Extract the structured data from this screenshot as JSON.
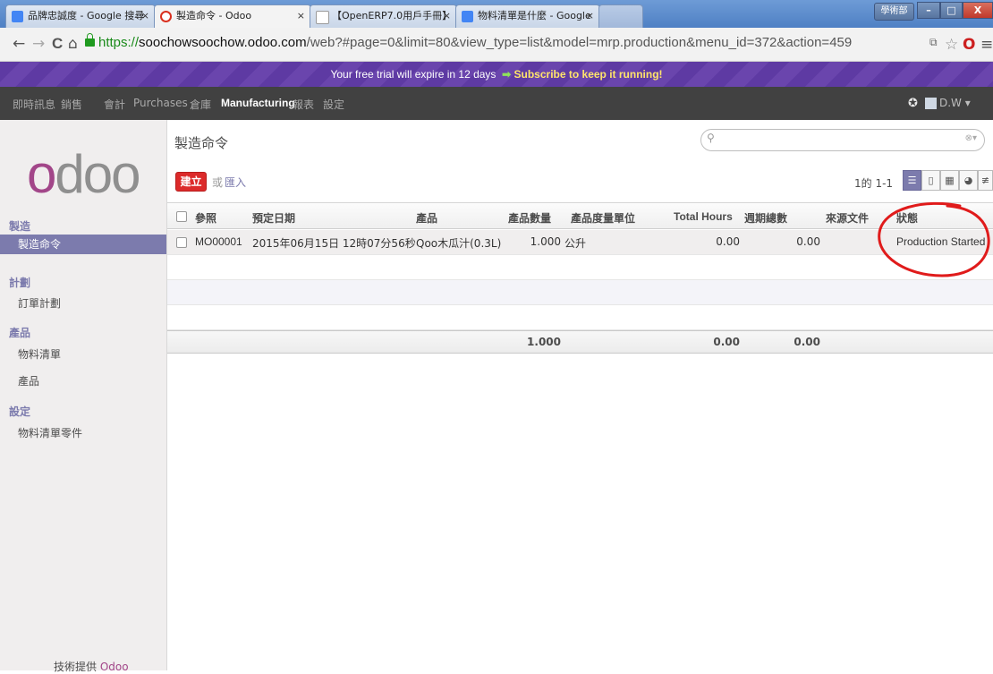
{
  "browser": {
    "tabs": [
      {
        "label": "品牌忠誠度 - Google 搜尋",
        "icon": "google-icon",
        "color": "#4285f4"
      },
      {
        "label": "製造命令 - Odoo",
        "icon": "odoo-icon",
        "color": "#d9301f"
      },
      {
        "label": "【OpenERP7.0用戶手冊】",
        "icon": "page-icon",
        "color": "#ffffff"
      },
      {
        "label": "物料清單是什麼 - Google",
        "icon": "google-icon",
        "color": "#4285f4"
      }
    ],
    "window_user": "學術部",
    "window_buttons": {
      "minimize": "–",
      "maximize": "□",
      "close": "X"
    },
    "url_scheme": "https://",
    "url_host": "soochowsoochow.odoo.com",
    "url_rest": "/web?#page=0&limit=80&view_type=list&model=mrp.production&menu_id=372&action=459",
    "nav": {
      "back": "←",
      "forward": "→",
      "reload": "C",
      "home": "⌂"
    }
  },
  "trial": {
    "text": "Your free trial will expire in 12 days",
    "arrow": "➡",
    "link": "Subscribe to keep it running!"
  },
  "topmenu": {
    "items": [
      "即時訊息",
      "銷售",
      "會計",
      "Purchases",
      "倉庫",
      "Manufacturing",
      "報表",
      "設定"
    ],
    "active": "Manufacturing",
    "user": "D.W ▾"
  },
  "sidebar": {
    "sections": [
      {
        "title": "製造",
        "items": [
          "製造命令"
        ]
      },
      {
        "title": "計劃",
        "items": [
          "訂單計劃"
        ]
      },
      {
        "title": "產品",
        "items": [
          "物料清單",
          "產品"
        ]
      },
      {
        "title": "設定",
        "items": [
          "物料清單零件"
        ]
      }
    ],
    "active_item": "製造命令",
    "powered_by": "技術提供",
    "powered_brand": "Odoo"
  },
  "main": {
    "title": "製造命令",
    "create_label": "建立",
    "or_label": "或",
    "import_label": "匯入",
    "pager": "1的 1-1",
    "search_placeholder": ""
  },
  "table": {
    "columns": [
      "參照",
      "預定日期",
      "產品",
      "產品數量",
      "產品度量單位",
      "Total Hours",
      "週期總數",
      "來源文件",
      "狀態"
    ],
    "rows": [
      {
        "ref": "MO00001",
        "date": "2015年06月15日 12時07分56秒",
        "product": "Qoo木瓜汁(0.3L)",
        "qty": "1.000",
        "uom": "公升",
        "total_hours": "0.00",
        "cycles": "0.00",
        "source": "",
        "status": "Production Started"
      }
    ],
    "totals": {
      "qty": "1.000",
      "total_hours": "0.00",
      "cycles": "0.00"
    }
  },
  "colors": {
    "brand": "#7c7bad",
    "create": "#dc2a2a",
    "annotation": "#e01b1b"
  }
}
